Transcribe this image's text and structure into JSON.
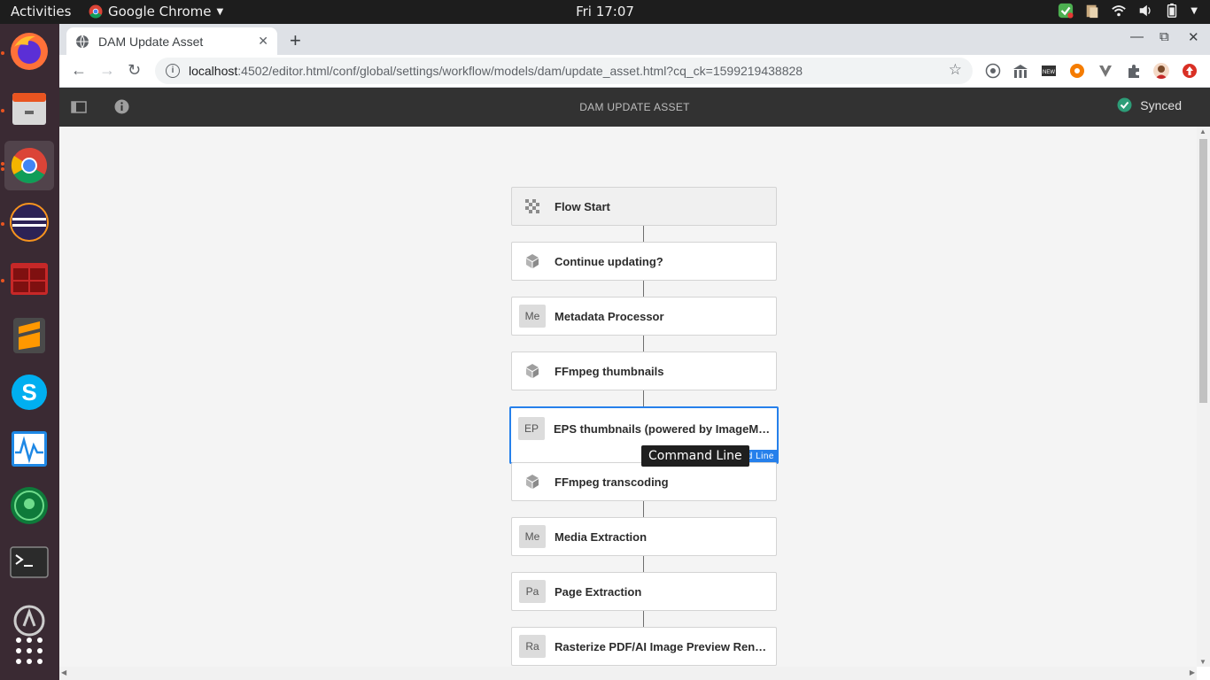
{
  "topbar": {
    "activities": "Activities",
    "app_name": "Google Chrome",
    "clock": "Fri 17:07"
  },
  "dock": {
    "items": [
      "firefox-icon",
      "files-icon",
      "chrome-icon",
      "eclipse-icon",
      "terminal-red-icon",
      "sublime-icon",
      "skype-icon",
      "monitor-icon",
      "gitkraken-icon",
      "terminal-icon",
      "updater-icon",
      "app-grid-icon"
    ]
  },
  "browser": {
    "tab_title": "DAM Update Asset",
    "url_host": "localhost",
    "url_path": ":4502/editor.html/conf/global/settings/workflow/models/dam/update_asset.html?cq_ck=1599219438828"
  },
  "editor": {
    "title": "DAM UPDATE ASSET",
    "status": "Synced",
    "tooltip": "Command Line",
    "selected_pill": "d Line",
    "steps": [
      {
        "badge": "",
        "icon": "flow-start-icon",
        "label": "Flow Start"
      },
      {
        "badge": "",
        "icon": "cube-icon",
        "label": "Continue updating?"
      },
      {
        "badge": "Me",
        "icon": "",
        "label": "Metadata Processor"
      },
      {
        "badge": "",
        "icon": "cube-icon",
        "label": "FFmpeg thumbnails"
      },
      {
        "badge": "EP",
        "icon": "",
        "label": "EPS thumbnails (powered by ImageMa..."
      },
      {
        "badge": "",
        "icon": "cube-icon",
        "label": "FFmpeg transcoding"
      },
      {
        "badge": "Me",
        "icon": "",
        "label": "Media Extraction"
      },
      {
        "badge": "Pa",
        "icon": "",
        "label": "Page Extraction"
      },
      {
        "badge": "Ra",
        "icon": "",
        "label": "Rasterize PDF/AI Image Preview Rendi..."
      }
    ]
  },
  "colors": {
    "accent": "#2680eb",
    "header_bg": "#323232",
    "synced_green": "#2d9d78"
  }
}
